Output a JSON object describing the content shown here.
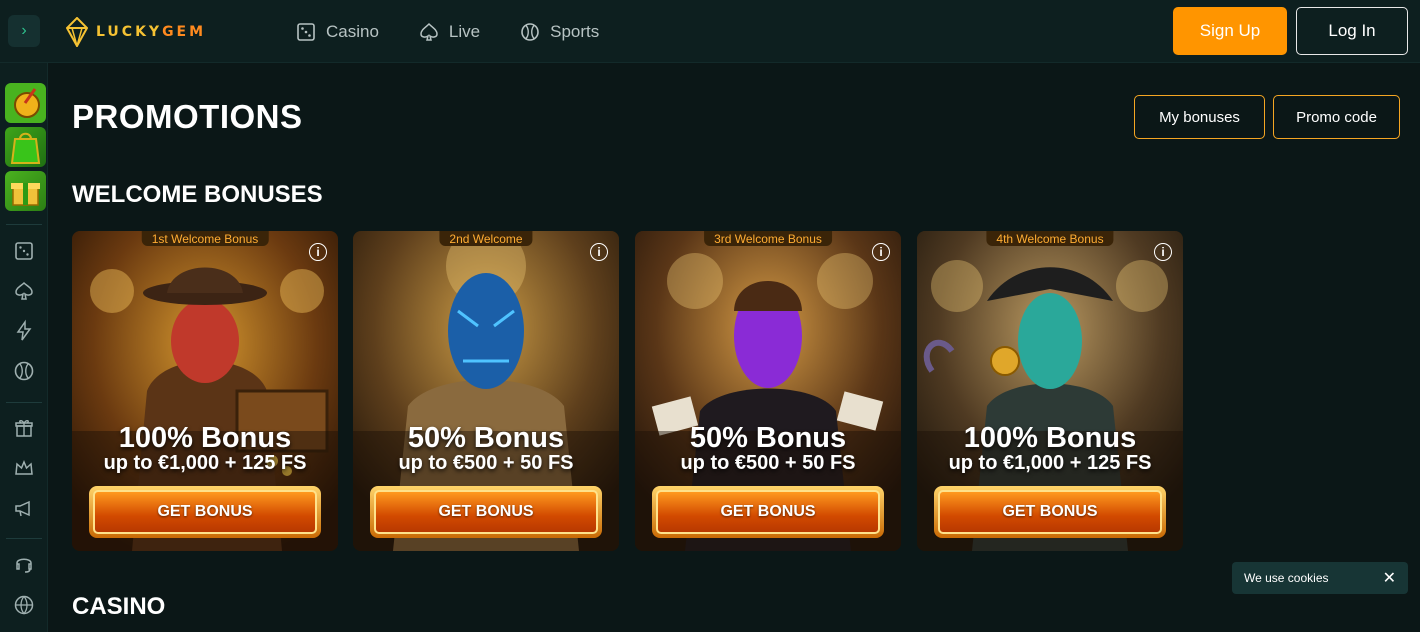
{
  "header": {
    "logo_prefix": "LUCKY",
    "logo_suffix": "GEM",
    "nav": [
      {
        "label": "Casino",
        "icon": "dice-icon"
      },
      {
        "label": "Live",
        "icon": "spade-icon"
      },
      {
        "label": "Sports",
        "icon": "ball-icon"
      }
    ],
    "signup_label": "Sign Up",
    "login_label": "Log In"
  },
  "page": {
    "title": "PROMOTIONS",
    "my_bonuses_label": "My bonuses",
    "promo_code_label": "Promo code",
    "welcome_title": "WELCOME BONUSES",
    "casino_title": "CASINO"
  },
  "cards": [
    {
      "tag": "1st Welcome Bonus",
      "headline": "100% Bonus",
      "sub": "up to €1,000 + 125 FS",
      "cta": "GET BONUS",
      "palette": "red"
    },
    {
      "tag": "2nd Welcome",
      "headline": "50% Bonus",
      "sub": "up to €500 + 50 FS",
      "cta": "GET BONUS",
      "palette": "blue"
    },
    {
      "tag": "3rd Welcome Bonus",
      "headline": "50% Bonus",
      "sub": "up to €500 + 50 FS",
      "cta": "GET BONUS",
      "palette": "purple"
    },
    {
      "tag": "4th Welcome Bonus",
      "headline": "100% Bonus",
      "sub": "up to €1,000 + 125 FS",
      "cta": "GET BONUS",
      "palette": "teal"
    }
  ],
  "info_glyph": "i",
  "cookie": {
    "text": "We use cookies",
    "close": "✕"
  },
  "colors": {
    "accent": "#ff9500",
    "outline": "#f5a623",
    "bg": "#0b1717",
    "panel": "#0d1f1f"
  }
}
